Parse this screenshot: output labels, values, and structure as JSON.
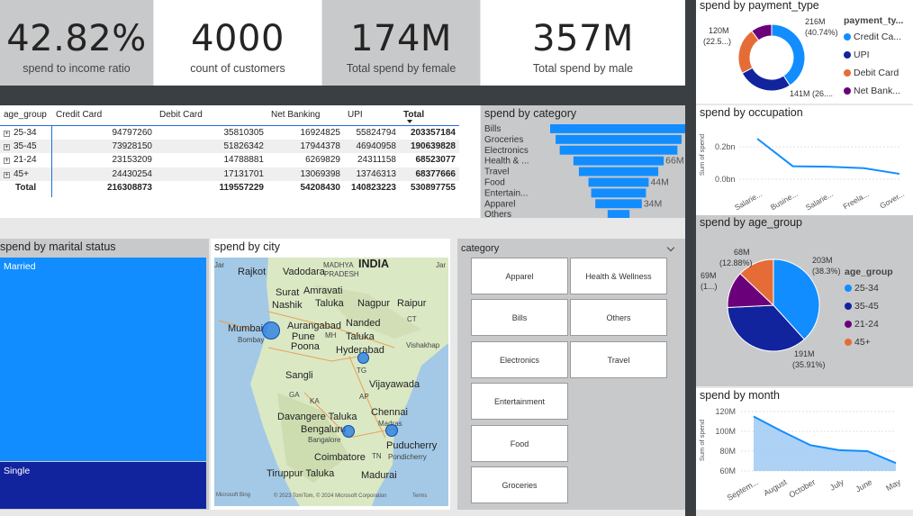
{
  "kpis": [
    {
      "value": "42.82%",
      "label": "spend to income ratio"
    },
    {
      "value": "4000",
      "label": "count of customers"
    },
    {
      "value": "174M",
      "label": "Total spend by female"
    },
    {
      "value": "357M",
      "label": "Total spend by male"
    }
  ],
  "matrix": {
    "headers": [
      "age_group",
      "Credit Card",
      "Debit Card",
      "Net Banking",
      "UPI",
      "Total"
    ],
    "rows": [
      {
        "group": "25-34",
        "cells": [
          "94797260",
          "35810305",
          "16924825",
          "55824794",
          "203357184"
        ]
      },
      {
        "group": "35-45",
        "cells": [
          "73928150",
          "51826342",
          "17944378",
          "46940958",
          "190639828"
        ]
      },
      {
        "group": "21-24",
        "cells": [
          "23153209",
          "14788881",
          "6269829",
          "24311158",
          "68523077"
        ]
      },
      {
        "group": "45+",
        "cells": [
          "24430254",
          "17131701",
          "13069398",
          "13746313",
          "68377666"
        ]
      }
    ],
    "total": {
      "group": "Total",
      "cells": [
        "216308873",
        "119557229",
        "54208430",
        "140823223",
        "530897755"
      ]
    }
  },
  "payment": {
    "title": "spend by payment_type",
    "legend_title": "payment_ty...",
    "legend": [
      {
        "name": "Credit Ca...",
        "color": "#118dff"
      },
      {
        "name": "UPI",
        "color": "#12239e"
      },
      {
        "name": "Debit Card",
        "color": "#e66c37"
      },
      {
        "name": "Net Bank...",
        "color": "#6b007b"
      }
    ],
    "labels": {
      "a1": "216M",
      "a2": "(40.74%)",
      "b1": "120M",
      "b2": "(22.5...)",
      "c": "141M (26...."
    },
    "chart_data": {
      "type": "pie",
      "categories": [
        "Credit Card",
        "UPI",
        "Debit Card",
        "Net Banking"
      ],
      "values": [
        216.31,
        140.82,
        119.56,
        54.21
      ]
    }
  },
  "category": {
    "title": "spend by category",
    "value_labels": {
      "health": "66M",
      "food": "44M",
      "apparel": "34M"
    },
    "chart_data": {
      "type": "bar",
      "categories": [
        "Bills",
        "Groceries",
        "Electronics",
        "Health & ...",
        "Travel",
        "Food",
        "Entertain...",
        "Apparel",
        "Others"
      ],
      "values": [
        100,
        92,
        86,
        66,
        58,
        44,
        40,
        34,
        16
      ]
    }
  },
  "occupation": {
    "title": "spend by occupation",
    "ylabel": "Sum of spend",
    "yticks": [
      "0.2bn",
      "0.0bn"
    ],
    "chart_data": {
      "type": "line",
      "categories": [
        "Salarie...",
        "Busine...",
        "Salarie...",
        "Freela...",
        "Gover..."
      ],
      "values": [
        0.25,
        0.08,
        0.077,
        0.068,
        0.033
      ],
      "ylim": [
        0,
        0.3
      ]
    }
  },
  "marital": {
    "title": "spend by marital status",
    "chart_data": {
      "type": "bar",
      "categories": [
        "Married",
        "Single"
      ],
      "values": [
        430,
        100
      ]
    }
  },
  "city": {
    "title": "spend by city",
    "labels": [
      "INDIA",
      "Rajkot",
      "Vadodara",
      "MADHYA",
      "PRADESH",
      "Surat",
      "Amravati",
      "Nashik",
      "Taluka",
      "Nagpur",
      "Raipur",
      "Aurangabad",
      "Nanded",
      "Mumbai",
      "Pune",
      "MH",
      "Taluka",
      "Bombay",
      "Poona",
      "Hyderabad",
      "Vishakhap",
      "Sangli",
      "TG",
      "Vijayawada",
      "GA",
      "KA",
      "AP",
      "Davangere Taluka",
      "Chennai",
      "Bengaluru",
      "Madras",
      "Bangalore",
      "Puducherry",
      "Coimbatore",
      "TN",
      "Pondicherry",
      "Tiruppur Taluka",
      "Madurai",
      "Jar",
      "Jar",
      "CT"
    ],
    "copyright": "© 2023 TomTom, © 2024 Microsoft Corporation",
    "terms": "Terms",
    "brand": "Microsoft Bing"
  },
  "slicer": {
    "title": "category",
    "items": [
      "Apparel",
      "Health & Wellness",
      "Bills",
      "Others",
      "Electronics",
      "Travel",
      "Entertainment",
      "Food",
      "Groceries"
    ]
  },
  "age": {
    "title": "spend by age_group",
    "legend_title": "age_group",
    "legend": [
      {
        "name": "25-34",
        "color": "#118dff"
      },
      {
        "name": "35-45",
        "color": "#12239e"
      },
      {
        "name": "21-24",
        "color": "#6b007b"
      },
      {
        "name": "45+",
        "color": "#e66c37"
      }
    ],
    "labels": {
      "a1": "203M",
      "a2": "(38.3%)",
      "b1": "191M",
      "b2": "(35.91%)",
      "c1": "69M",
      "c2": "(1...)",
      "d1": "68M",
      "d2": "(12.88%)"
    },
    "chart_data": {
      "type": "pie",
      "categories": [
        "25-34",
        "35-45",
        "21-24",
        "45+"
      ],
      "values": [
        203.36,
        190.64,
        68.52,
        68.38
      ]
    }
  },
  "month": {
    "title": "spend by month",
    "ylabel": "Sum of spend",
    "yticks": [
      "120M",
      "100M",
      "80M",
      "60M"
    ],
    "chart_data": {
      "type": "area",
      "categories": [
        "Septem...",
        "August",
        "October",
        "July",
        "June",
        "May"
      ],
      "values": [
        115,
        100,
        86,
        81,
        80,
        68
      ],
      "ylim": [
        60,
        120
      ]
    }
  }
}
